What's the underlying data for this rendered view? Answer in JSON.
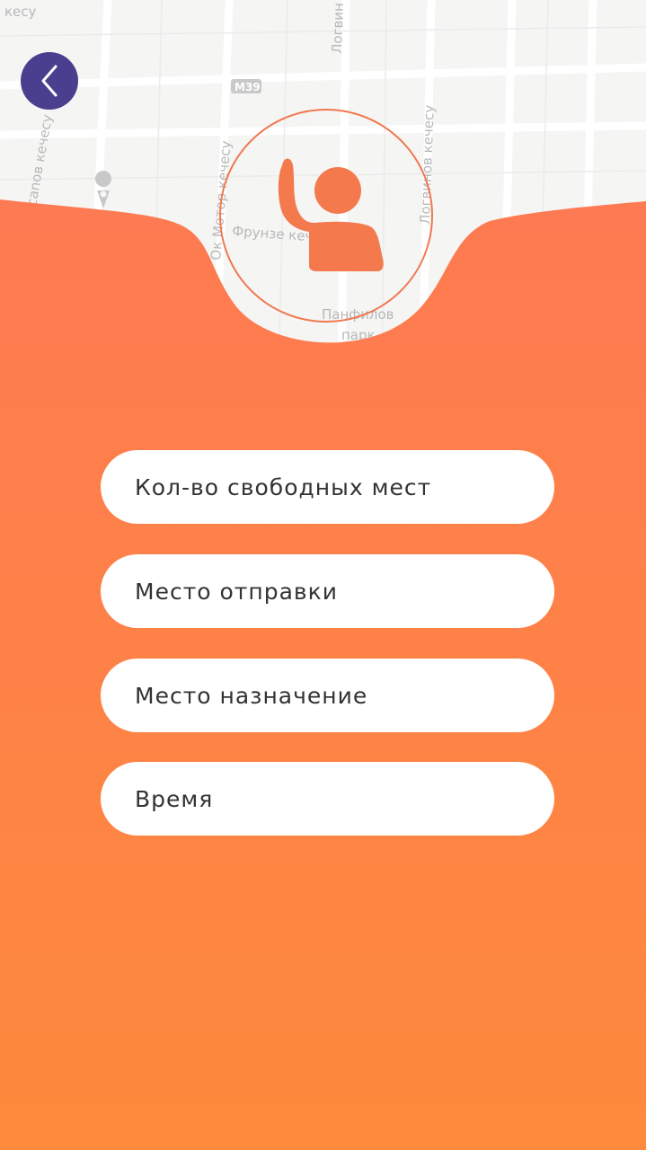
{
  "map": {
    "labels": {
      "road_m39": "M39",
      "street_top_left": "кесу",
      "street_top_mid": "Логвин",
      "street_left": "сanов кечесу",
      "street_center": "Ок Мотор кечесу",
      "street_frunze": "Фрунзе кечесу",
      "street_right": "Логвинов кечесу",
      "park": "Панфилов",
      "park2": "парк"
    }
  },
  "back_button": {
    "icon": "chevron-left-icon"
  },
  "header_icon": {
    "icon": "raised-hand-person-icon"
  },
  "colors": {
    "accent_top": "#fe7a52",
    "accent_bottom": "#fe8a3c",
    "back_button": "#4a3f8e",
    "field_bg": "#ffffff"
  },
  "form": {
    "fields": [
      {
        "placeholder": "Кол-во свободных мест"
      },
      {
        "placeholder": "Место отправки"
      },
      {
        "placeholder": "Место назначение"
      },
      {
        "placeholder": "Время"
      }
    ]
  }
}
